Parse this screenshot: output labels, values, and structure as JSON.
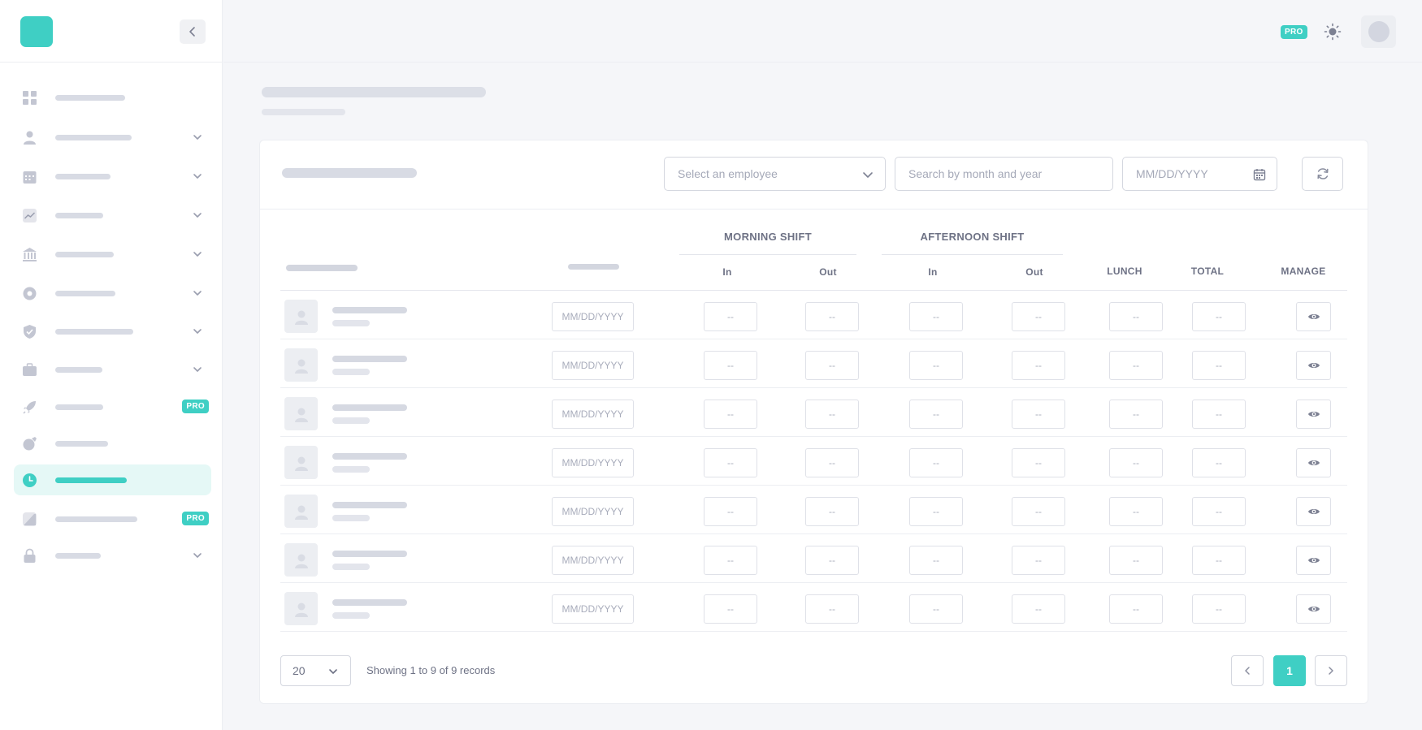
{
  "header": {
    "pro_badge": "PRO",
    "theme_icon": "sun-icon",
    "avatar_icon": "user-avatar"
  },
  "sidebar": {
    "logo_icon": "app-logo",
    "collapse_icon": "chevron-left-icon",
    "items": [
      {
        "icon": "dashboard-icon",
        "has_chevron": false,
        "pro": ""
      },
      {
        "icon": "user-icon",
        "has_chevron": true,
        "pro": ""
      },
      {
        "icon": "calendar-icon",
        "has_chevron": true,
        "pro": ""
      },
      {
        "icon": "chart-line-icon",
        "has_chevron": true,
        "pro": ""
      },
      {
        "icon": "bank-icon",
        "has_chevron": true,
        "pro": ""
      },
      {
        "icon": "settings-icon",
        "has_chevron": true,
        "pro": ""
      },
      {
        "icon": "shield-check-icon",
        "has_chevron": true,
        "pro": ""
      },
      {
        "icon": "briefcase-icon",
        "has_chevron": true,
        "pro": ""
      },
      {
        "icon": "rocket-icon",
        "has_chevron": false,
        "pro": "PRO"
      },
      {
        "icon": "edit-icon",
        "has_chevron": false,
        "pro": ""
      },
      {
        "icon": "clock-icon",
        "has_chevron": false,
        "pro": "",
        "active": true
      },
      {
        "icon": "chart-area-icon",
        "has_chevron": false,
        "pro": "PRO"
      },
      {
        "icon": "lock-icon",
        "has_chevron": true,
        "pro": ""
      }
    ]
  },
  "filters": {
    "employee_placeholder": "Select an employee",
    "month_placeholder": "Search by month and year",
    "date_placeholder": "MM/DD/YYYY"
  },
  "table": {
    "morning_shift": "MORNING SHIFT",
    "afternoon_shift": "AFTERNOON SHIFT",
    "in_label": "In",
    "out_label": "Out",
    "lunch_label": "LUNCH",
    "total_label": "TOTAL",
    "manage_label": "MANAGE",
    "date_placeholder": "MM/DD/YYYY",
    "empty_value": "--",
    "rows": [
      {
        "date": "MM/DD/YYYY",
        "morning_in": "--",
        "morning_out": "--",
        "afternoon_in": "--",
        "afternoon_out": "--",
        "lunch": "--",
        "total": "--"
      },
      {
        "date": "MM/DD/YYYY",
        "morning_in": "--",
        "morning_out": "--",
        "afternoon_in": "--",
        "afternoon_out": "--",
        "lunch": "--",
        "total": "--"
      },
      {
        "date": "MM/DD/YYYY",
        "morning_in": "--",
        "morning_out": "--",
        "afternoon_in": "--",
        "afternoon_out": "--",
        "lunch": "--",
        "total": "--"
      },
      {
        "date": "MM/DD/YYYY",
        "morning_in": "--",
        "morning_out": "--",
        "afternoon_in": "--",
        "afternoon_out": "--",
        "lunch": "--",
        "total": "--"
      },
      {
        "date": "MM/DD/YYYY",
        "morning_in": "--",
        "morning_out": "--",
        "afternoon_in": "--",
        "afternoon_out": "--",
        "lunch": "--",
        "total": "--"
      },
      {
        "date": "MM/DD/YYYY",
        "morning_in": "--",
        "morning_out": "--",
        "afternoon_in": "--",
        "afternoon_out": "--",
        "lunch": "--",
        "total": "--"
      },
      {
        "date": "MM/DD/YYYY",
        "morning_in": "--",
        "morning_out": "--",
        "afternoon_in": "--",
        "afternoon_out": "--",
        "lunch": "--",
        "total": "--"
      }
    ]
  },
  "pagination": {
    "per_page": "20",
    "records_text": "Showing 1 to 9 of 9 records",
    "current_page": "1"
  },
  "colors": {
    "accent": "#3fcfc4",
    "background": "#f5f6f9"
  }
}
